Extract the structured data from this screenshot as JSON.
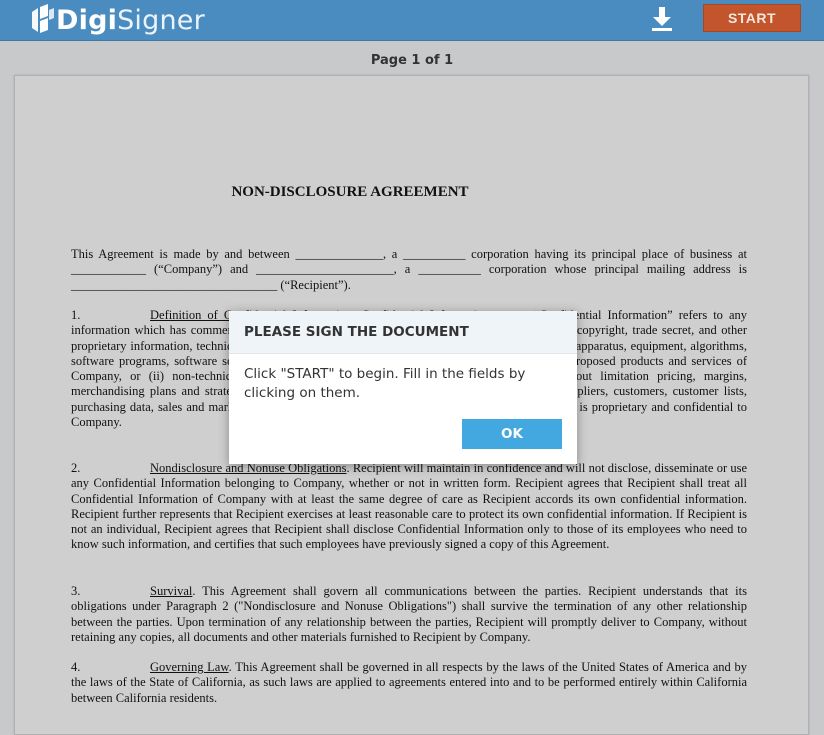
{
  "app": {
    "logo": {
      "bold": "Digi",
      "light": "Signer"
    },
    "start_label": "START",
    "download_icon": "download-icon",
    "colors": {
      "header": "#4a8cc0",
      "start": "#c2552b",
      "ok": "#44a8e0"
    }
  },
  "viewer": {
    "page_indicator": "Page 1 of 1"
  },
  "document": {
    "title": "NON-DISCLOSURE AGREEMENT",
    "intro": "This Agreement is made by and between ______________, a __________ corporation having its principal place of business at ____________ (“Company”) and ______________________, a __________ corporation whose principal mailing address is _________________________________ (“Recipient”).",
    "sections": [
      {
        "num": "1.",
        "heading": "Definition of Confidential Information",
        "text": ". Confidential Information means “Confidential Information” refers to any information which has commercial value and is either (i) technical information, including patent, copyright, trade secret, and other proprietary information, techniques, sketches, drawings, models, inventions, know-how, processes, apparatus, equipment, algorithms, software programs, software source documents, and formulae related to the current, future and proposed products and services of Company, or (ii) non-technical information relating to Company's products, including without limitation pricing, margins, merchandising plans and strategies, finances, financial and accounting data and information, suppliers, customers, customer lists, purchasing data, sales and marketing plans, future business plans and any other information which is proprietary and confidential to Company."
      },
      {
        "num": "2.",
        "heading": "Nondisclosure and Nonuse Obligations",
        "text": ". Recipient will maintain in confidence and will not disclose, disseminate or use any Confidential Information belonging to Company, whether or not in written form.  Recipient agrees that Recipient shall treat all Confidential Information of Company with at least the same degree of care as Recipient accords its own confidential information.  Recipient further represents that Recipient exercises at least reasonable care to protect its own confidential information.  If Recipient is not an individual, Recipient agrees that Recipient shall disclose Confidential Information only to those of its employees who need to know such information, and certifies that such employees have previously signed a copy of this Agreement."
      },
      {
        "num": "3.",
        "heading": "Survival",
        "text": ".  This Agreement shall govern all communications between the parties.  Recipient understands that its obligations under Paragraph 2 (\"Nondisclosure and Nonuse Obligations\") shall survive the termination of any other relationship between the parties.  Upon termination of any relationship between the parties, Recipient will promptly deliver to Company, without retaining any copies, all documents and other materials furnished to Recipient by Company."
      },
      {
        "num": "4.",
        "heading": "Governing Law",
        "text": ".  This Agreement shall be governed in all respects by the laws of the United States of America and by the laws of the State of California, as such laws are applied to agreements entered into and to be performed entirely within California between California residents."
      }
    ]
  },
  "modal": {
    "title": "PLEASE SIGN THE DOCUMENT",
    "message": "Click \"START\" to begin. Fill in the fields by clicking on them.",
    "ok_label": "OK"
  }
}
